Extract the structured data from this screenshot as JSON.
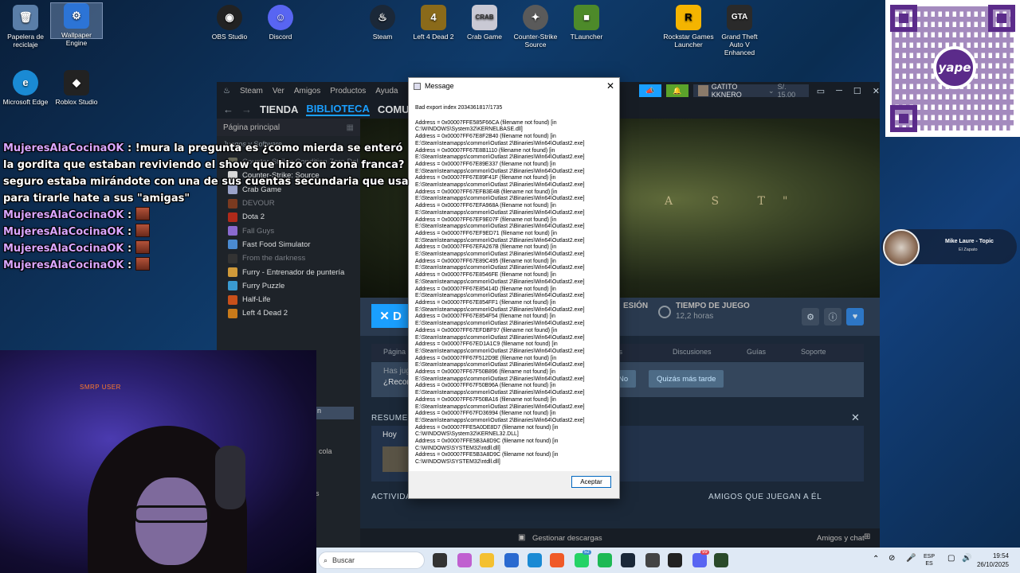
{
  "desktop_icons": [
    {
      "label": "Papelera de reciclaje",
      "icon": "recycle-bin-icon",
      "color": "#5a7ea8"
    },
    {
      "label": "Wallpaper Engine",
      "icon": "wallpaper-engine-icon",
      "color": "#2c74d6"
    },
    {
      "label": "OBS Studio",
      "icon": "obs-icon",
      "color": "#222222"
    },
    {
      "label": "Discord",
      "icon": "discord-icon",
      "color": "#5865f2"
    },
    {
      "label": "Steam",
      "icon": "steam-icon",
      "color": "#1b2838"
    },
    {
      "label": "Left 4 Dead 2",
      "icon": "l4d2-icon",
      "color": "#8a6a1a"
    },
    {
      "label": "Crab Game",
      "icon": "crab-game-icon",
      "color": "#c9c9d4"
    },
    {
      "label": "Counter-Strike Source",
      "icon": "counter-strike-icon",
      "color": "#5a5a5a"
    },
    {
      "label": "TLauncher",
      "icon": "tlauncher-icon",
      "color": "#4d8a2a"
    },
    {
      "label": "Rockstar Games Launcher",
      "icon": "rockstar-icon",
      "color": "#f4b400"
    },
    {
      "label": "Grand Theft Auto V Enhanced",
      "icon": "gta-icon",
      "color": "#2a2a2a"
    },
    {
      "label": "Microsoft Edge",
      "icon": "edge-icon",
      "color": "#1a8ad4"
    },
    {
      "label": "Roblox Studio",
      "icon": "roblox-icon",
      "color": "#222222"
    }
  ],
  "qr": {
    "brand": "yape",
    "color": "#5b2b8a"
  },
  "steam": {
    "menu": [
      "Steam",
      "Ver",
      "Amigos",
      "Productos",
      "Ayuda"
    ],
    "nav": [
      "TIENDA",
      "BIBLIOTECA",
      "COMUNI"
    ],
    "home_label": "Página principal",
    "category_label": "Juegos y Software",
    "games": [
      {
        "name": "Counter-Strike: Condition Zero Del",
        "dim": true,
        "color": "#6a6a5a"
      },
      {
        "name": "Counter-Strike: Source",
        "dim": false,
        "color": "#d9d9d9"
      },
      {
        "name": "Crab Game",
        "dim": false,
        "color": "#9aa3c9"
      },
      {
        "name": "DEVOUR",
        "dim": true,
        "color": "#7a3a20"
      },
      {
        "name": "Dota 2",
        "dim": false,
        "color": "#b02a1a"
      },
      {
        "name": "Fall Guys",
        "dim": true,
        "color": "#8a6ad0"
      },
      {
        "name": "Fast Food Simulator",
        "dim": false,
        "color": "#4a8ad0"
      },
      {
        "name": "From the darkness",
        "dim": true,
        "color": "#333333"
      },
      {
        "name": "Furry - Entrenador de puntería",
        "dim": false,
        "color": "#d09a3a"
      },
      {
        "name": "Furry Puzzle",
        "dim": false,
        "color": "#3a9ad0"
      },
      {
        "name": "Half-Life",
        "dim": false,
        "color": "#c8501a"
      },
      {
        "name": "Left 4 Dead 2",
        "dim": false,
        "color": "#c87a1a"
      }
    ],
    "hero_title": "A S T\"",
    "play_label": "✕ D",
    "sesion_label": "ESIÓN",
    "playtime_label": "TIEMPO DE JUEGO",
    "playtime_value": "12,2 horas",
    "tabs": [
      "Página",
      "intos",
      "Discusiones",
      "Guías",
      "Soporte"
    ],
    "review_line1": "Has jug",
    "review_line2": "¿Recon",
    "review_no": "No",
    "review_later": "Quizás más tarde",
    "resumen_label": "RESUMEN",
    "hoy_label": "Hoy",
    "actividad_label": "ACTIVIDA",
    "amigos_label": "AMIGOS QUE JUEGAN A ÉL",
    "left_extra": [
      "n",
      "cola",
      "s"
    ],
    "manage_downloads": "Gestionar descargas",
    "friends_chat": "Amigos y chat",
    "user_name": "GATITO KKNERO",
    "user_balance": "S/. 15.00"
  },
  "dialog": {
    "title": "Message",
    "header": "Bad export index 2034361817/1735",
    "lines": [
      "Address = 0x00007FFE585F66CA (filename not found) [in C:\\WINDOWS\\System32\\KERNELBASE.dll]",
      "Address = 0x00007FF67E8F2B40 (filename not found) [in E:\\Steam\\steamapps\\common\\Outlast 2\\Binaries\\Win64\\Outlast2.exe]",
      "Address = 0x00007FF67E8B1110 (filename not found) [in E:\\Steam\\steamapps\\common\\Outlast 2\\Binaries\\Win64\\Outlast2.exe]",
      "Address = 0x00007FF67E89E337 (filename not found) [in E:\\Steam\\steamapps\\common\\Outlast 2\\Binaries\\Win64\\Outlast2.exe]",
      "Address = 0x00007FF67E89F41F (filename not found) [in E:\\Steam\\steamapps\\common\\Outlast 2\\Binaries\\Win64\\Outlast2.exe]",
      "Address = 0x00007FF67EFB3E4B (filename not found) [in E:\\Steam\\steamapps\\common\\Outlast 2\\Binaries\\Win64\\Outlast2.exe]",
      "Address = 0x00007FF67EFA968A (filename not found) [in E:\\Steam\\steamapps\\common\\Outlast 2\\Binaries\\Win64\\Outlast2.exe]",
      "Address = 0x00007FF67EF9E07F (filename not found) [in E:\\Steam\\steamapps\\common\\Outlast 2\\Binaries\\Win64\\Outlast2.exe]",
      "Address = 0x00007FF67EF9ED71 (filename not found) [in E:\\Steam\\steamapps\\common\\Outlast 2\\Binaries\\Win64\\Outlast2.exe]",
      "Address = 0x00007FF67EFA267B (filename not found) [in E:\\Steam\\steamapps\\common\\Outlast 2\\Binaries\\Win64\\Outlast2.exe]",
      "Address = 0x00007FF67E89C495 (filename not found) [in E:\\Steam\\steamapps\\common\\Outlast 2\\Binaries\\Win64\\Outlast2.exe]",
      "Address = 0x00007FF67E8546FE (filename not found) [in E:\\Steam\\steamapps\\common\\Outlast 2\\Binaries\\Win64\\Outlast2.exe]",
      "Address = 0x00007FF67E85414D (filename not found) [in E:\\Steam\\steamapps\\common\\Outlast 2\\Binaries\\Win64\\Outlast2.exe]",
      "Address = 0x00007FF67E854FF1 (filename not found) [in E:\\Steam\\steamapps\\common\\Outlast 2\\Binaries\\Win64\\Outlast2.exe]",
      "Address = 0x00007FF67E854F54 (filename not found) [in E:\\Steam\\steamapps\\common\\Outlast 2\\Binaries\\Win64\\Outlast2.exe]",
      "Address = 0x00007FF67EFDBF97 (filename not found) [in E:\\Steam\\steamapps\\common\\Outlast 2\\Binaries\\Win64\\Outlast2.exe]",
      "Address = 0x00007FF67ED1A1C9 (filename not found) [in E:\\Steam\\steamapps\\common\\Outlast 2\\Binaries\\Win64\\Outlast2.exe]",
      "Address = 0x00007FF67F512D9E (filename not found) [in E:\\Steam\\steamapps\\common\\Outlast 2\\Binaries\\Win64\\Outlast2.exe]",
      "Address = 0x00007FF67F50B896 (filename not found) [in E:\\Steam\\steamapps\\common\\Outlast 2\\Binaries\\Win64\\Outlast2.exe]",
      "Address = 0x00007FF67F50B96A (filename not found) [in E:\\Steam\\steamapps\\common\\Outlast 2\\Binaries\\Win64\\Outlast2.exe]",
      "Address = 0x00007FF67F50BA16 (filename not found) [in E:\\Steam\\steamapps\\common\\Outlast 2\\Binaries\\Win64\\Outlast2.exe]",
      "Address = 0x00007FF67FD36994 (filename not found) [in E:\\Steam\\steamapps\\common\\Outlast 2\\Binaries\\Win64\\Outlast2.exe]",
      "Address = 0x00007FFE5A0DE8D7 (filename not found) [in C:\\WINDOWS\\System32\\KERNEL32.DLL]",
      "Address = 0x00007FFE5B3A8D9C (filename not found) [in C:\\WINDOWS\\SYSTEM32\\ntdll.dll]",
      "Address = 0x00007FFE5B3A8D9C (filename not found) [in C:\\WINDOWS\\SYSTEM32\\ntdll.dll]"
    ],
    "ok_label": "Aceptar"
  },
  "chat": {
    "messages": [
      {
        "user": "MujeresAlaCocinaOK",
        "text": " : !mura la pregunta es ¿como mierda se enteró la gordita que estaban reviviendo el show que hizo con zona franca? seguro estaba mirándote con una de sus cuentas secundaria que usa para tirarle hate a sus \"amigas\"",
        "emote": false
      },
      {
        "user": "MujeresAlaCocinaOK",
        "text": " : ",
        "emote": true
      },
      {
        "user": "MujeresAlaCocinaOK",
        "text": " : ",
        "emote": true
      },
      {
        "user": "MujeresAlaCocinaOK",
        "text": " : ",
        "emote": true
      },
      {
        "user": "MujeresAlaCocinaOK",
        "text": " : ",
        "emote": true
      }
    ]
  },
  "webcam": {
    "label": "SMRP USER"
  },
  "music": {
    "title": "Mike Laure - Topic",
    "subtitle": "El Zapato"
  },
  "taskbar": {
    "search_placeholder": "Buscar",
    "apps": [
      {
        "icon": "task-view-icon",
        "color": "#333333"
      },
      {
        "icon": "copilot-icon",
        "color": "#c060d0"
      },
      {
        "icon": "file-explorer-icon",
        "color": "#f4c030"
      },
      {
        "icon": "store-icon",
        "color": "#2a6ad0"
      },
      {
        "icon": "edge-icon",
        "color": "#1a8ad4"
      },
      {
        "icon": "brave-icon",
        "color": "#f05a28"
      },
      {
        "icon": "whatsapp-icon",
        "color": "#25d366"
      },
      {
        "icon": "spotify-icon",
        "color": "#1db954"
      },
      {
        "icon": "steam-icon",
        "color": "#1b2838"
      },
      {
        "icon": "record-icon",
        "color": "#444444"
      },
      {
        "icon": "obs-icon",
        "color": "#222222"
      },
      {
        "icon": "discord-icon",
        "color": "#5865f2"
      },
      {
        "icon": "tlauncher-icon",
        "color": "#2a4a2a"
      }
    ],
    "badges": {
      "whatsapp": "52",
      "discord": "99"
    },
    "lang_top": "ESP",
    "lang_bottom": "ES",
    "time": "19:54",
    "date": "26/10/2025"
  }
}
